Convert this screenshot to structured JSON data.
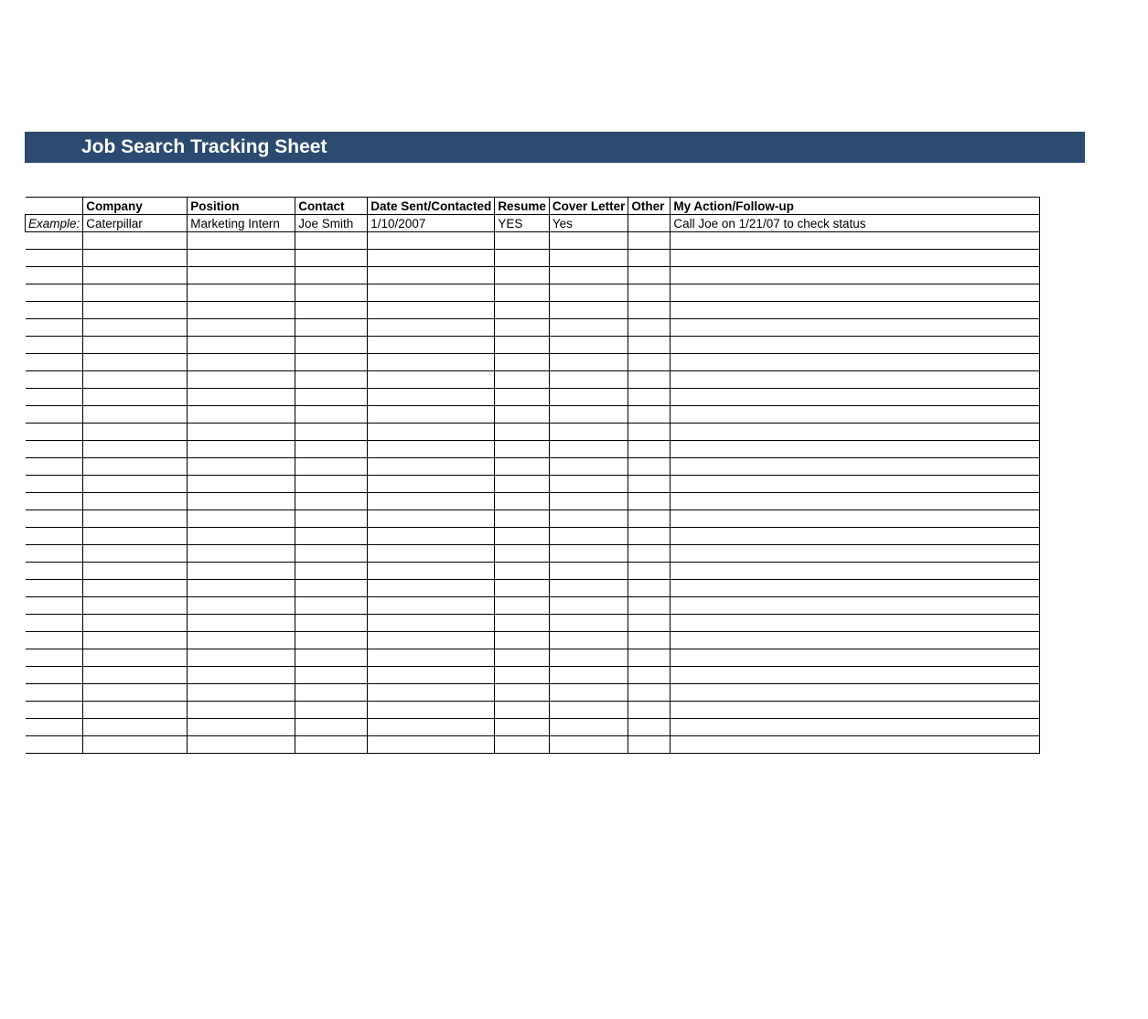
{
  "title": "Job Search Tracking Sheet",
  "columns": {
    "label_col": "",
    "company": "Company",
    "position": "Position",
    "contact": "Contact",
    "date_sent": "Date Sent/Contacted",
    "resume": "Resume",
    "cover_letter": "Cover Letter",
    "other": "Other",
    "action": "My Action/Follow-up"
  },
  "example_row": {
    "label": "Example:",
    "company": "Caterpillar",
    "position": "Marketing Intern",
    "contact": "Joe Smith",
    "date_sent": "1/10/2007",
    "resume": "YES",
    "cover_letter": "Yes",
    "other": "",
    "action": "Call Joe on 1/21/07 to check status"
  },
  "empty_row_count": 30
}
